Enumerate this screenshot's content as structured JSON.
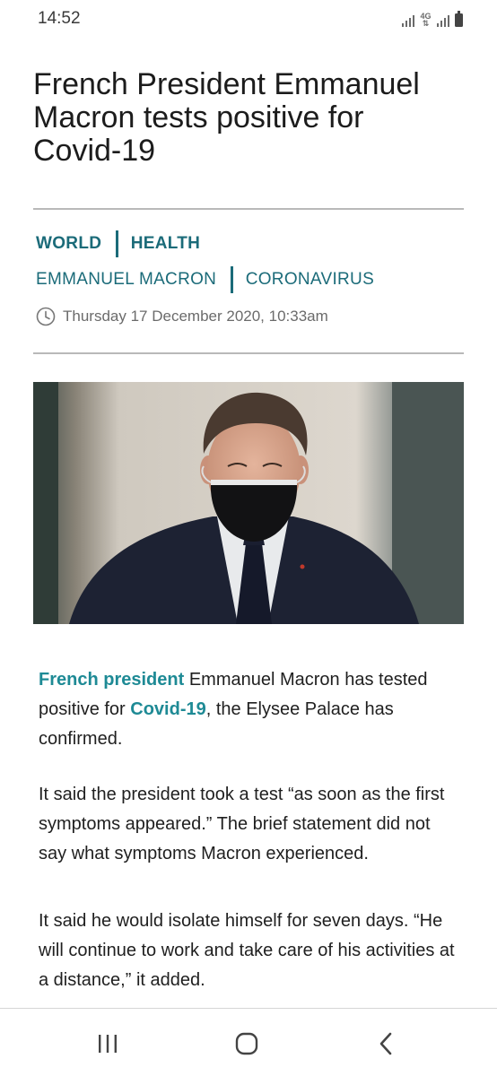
{
  "status_bar": {
    "time": "14:52",
    "network_label": "4G",
    "icons": [
      "signal-icon",
      "4g-data-icon",
      "signal-icon",
      "battery-icon"
    ]
  },
  "article": {
    "headline": "French President Emmanuel Macron tests positive for Covid-19",
    "sections": [
      "WORLD",
      "HEALTH"
    ],
    "topics": [
      "EMMANUEL MACRON",
      "CORONAVIRUS"
    ],
    "date": "Thursday 17 December 2020, 10:33am",
    "photo": {
      "subject": "man-in-black-face-mask"
    },
    "paragraph1": {
      "link1": "French president",
      "text1": " Emmanuel Macron has tested positive for ",
      "link2": "Covid-19",
      "text2": ", the Elysee Palace has confirmed."
    },
    "paragraph2": "It said the president took a test “as soon as the first symptoms appeared.” The brief statement did not say what symptoms Macron experienced.",
    "paragraph3": "It said he would isolate himself for seven days. “He will continue to work and take care of his activities at a distance,” it added."
  },
  "nav_bar": {
    "buttons": [
      "recent-apps-icon",
      "home-icon",
      "back-icon"
    ]
  },
  "colors": {
    "accent": "#1b6b79",
    "link": "#1e8a95",
    "text": "#1f1f1f",
    "rule": "#b9b9b9"
  }
}
